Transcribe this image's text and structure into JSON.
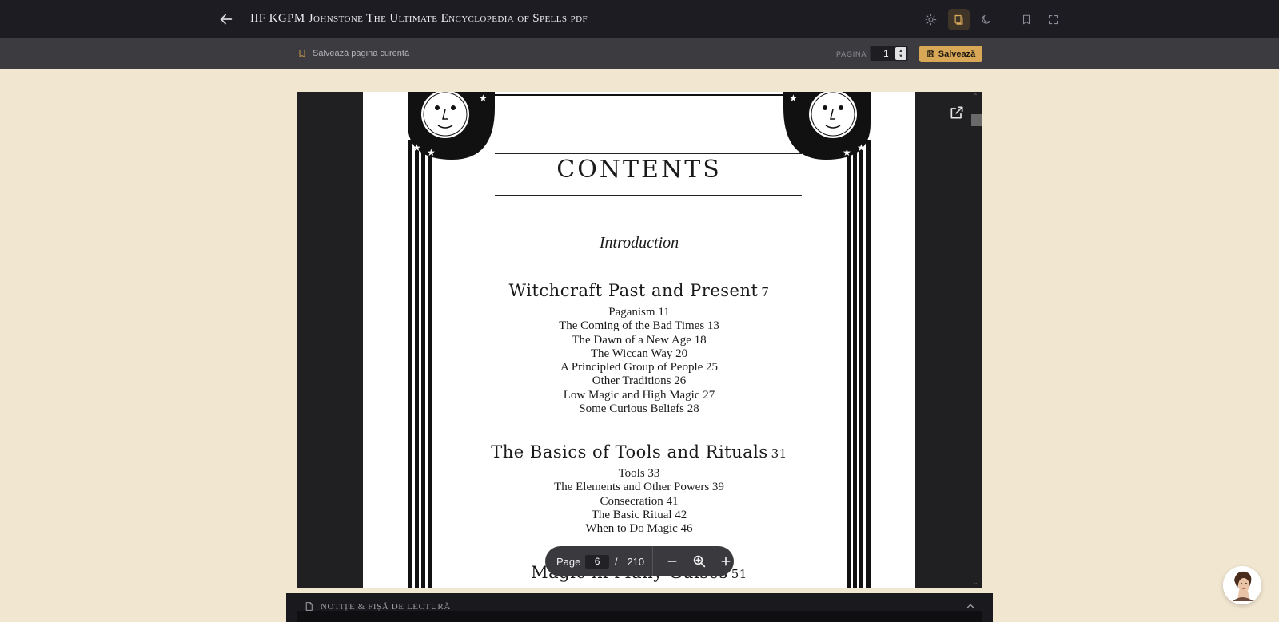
{
  "header": {
    "title": "IIF KGPM Johnstone The Ultimate Encyclopedia of Spells pdf",
    "icons": [
      "arrow-left-icon",
      "sun-icon",
      "sepia-book-icon",
      "moon-icon",
      "bookmark-icon",
      "fullscreen-icon"
    ]
  },
  "subbar": {
    "save_current_label": "Salvează pagina curentă",
    "page_label": "PAGINA",
    "page_value": "1",
    "save_button_label": "Salvează"
  },
  "pdf": {
    "contents_title": "CONTENTS",
    "introduction": "Introduction",
    "sections": [
      {
        "title": "Witchcraft Past and Present",
        "page": "7",
        "items": [
          "Paganism  11",
          "The Coming of the Bad Times  13",
          "The Dawn of a New Age  18",
          "The Wiccan Way  20",
          "A Principled Group of People  25",
          "Other Traditions  26",
          "Low Magic and High Magic  27",
          "Some Curious Beliefs  28"
        ]
      },
      {
        "title": "The Basics of Tools and Rituals",
        "page": "31",
        "items": [
          "Tools  33",
          "The Elements and Other Powers  39",
          "Consecration  41",
          "The Basic Ritual  42",
          "When to Do Magic  46"
        ]
      },
      {
        "title": "Magic in Many Guises",
        "page": "51",
        "items": []
      }
    ]
  },
  "pagebar": {
    "label": "Page",
    "current": "6",
    "separator": "/",
    "total": "210"
  },
  "notes": {
    "label": "NOTIȚE & FIȘĂ DE LECTURĂ"
  },
  "colors": {
    "topbar": "#1c1c22",
    "subbar": "#3b3b40",
    "accent": "#d8a857",
    "page_bg": "#f1e6d0"
  }
}
